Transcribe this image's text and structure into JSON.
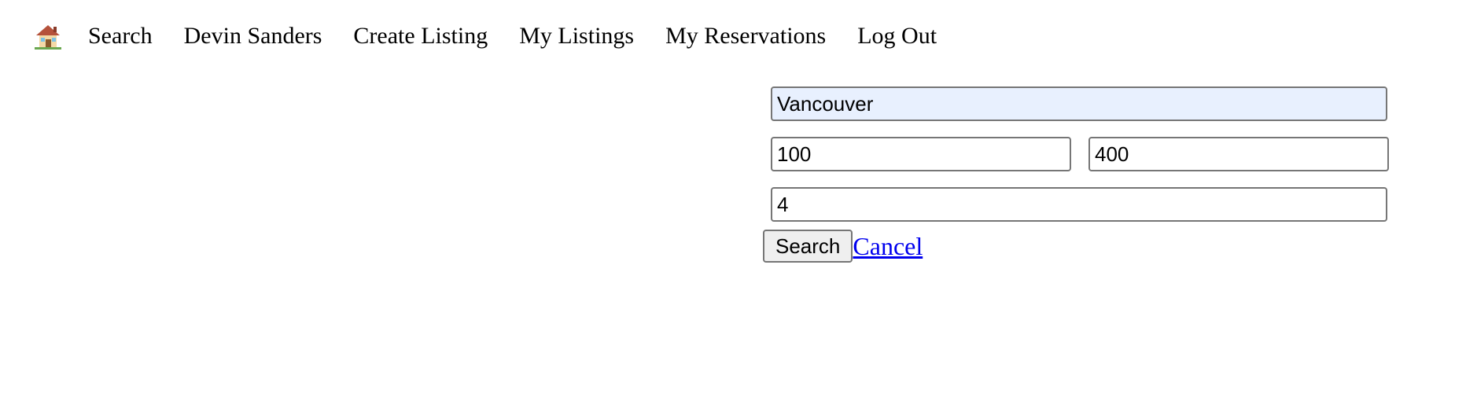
{
  "nav": {
    "home_icon": "house-icon",
    "items": [
      {
        "label": "Search"
      },
      {
        "label": "Devin Sanders"
      },
      {
        "label": "Create Listing"
      },
      {
        "label": "My Listings"
      },
      {
        "label": "My Reservations"
      },
      {
        "label": "Log Out"
      }
    ]
  },
  "search_form": {
    "location": {
      "value": "Vancouver"
    },
    "min_price": {
      "value": "100"
    },
    "max_price": {
      "value": "400"
    },
    "guests": {
      "value": "4"
    },
    "search_button_label": "Search",
    "cancel_label": "Cancel"
  },
  "colors": {
    "link": "#0000ee",
    "autofill_bg": "#e8f0fe",
    "button_bg": "#efefef",
    "input_border": "#767676"
  }
}
